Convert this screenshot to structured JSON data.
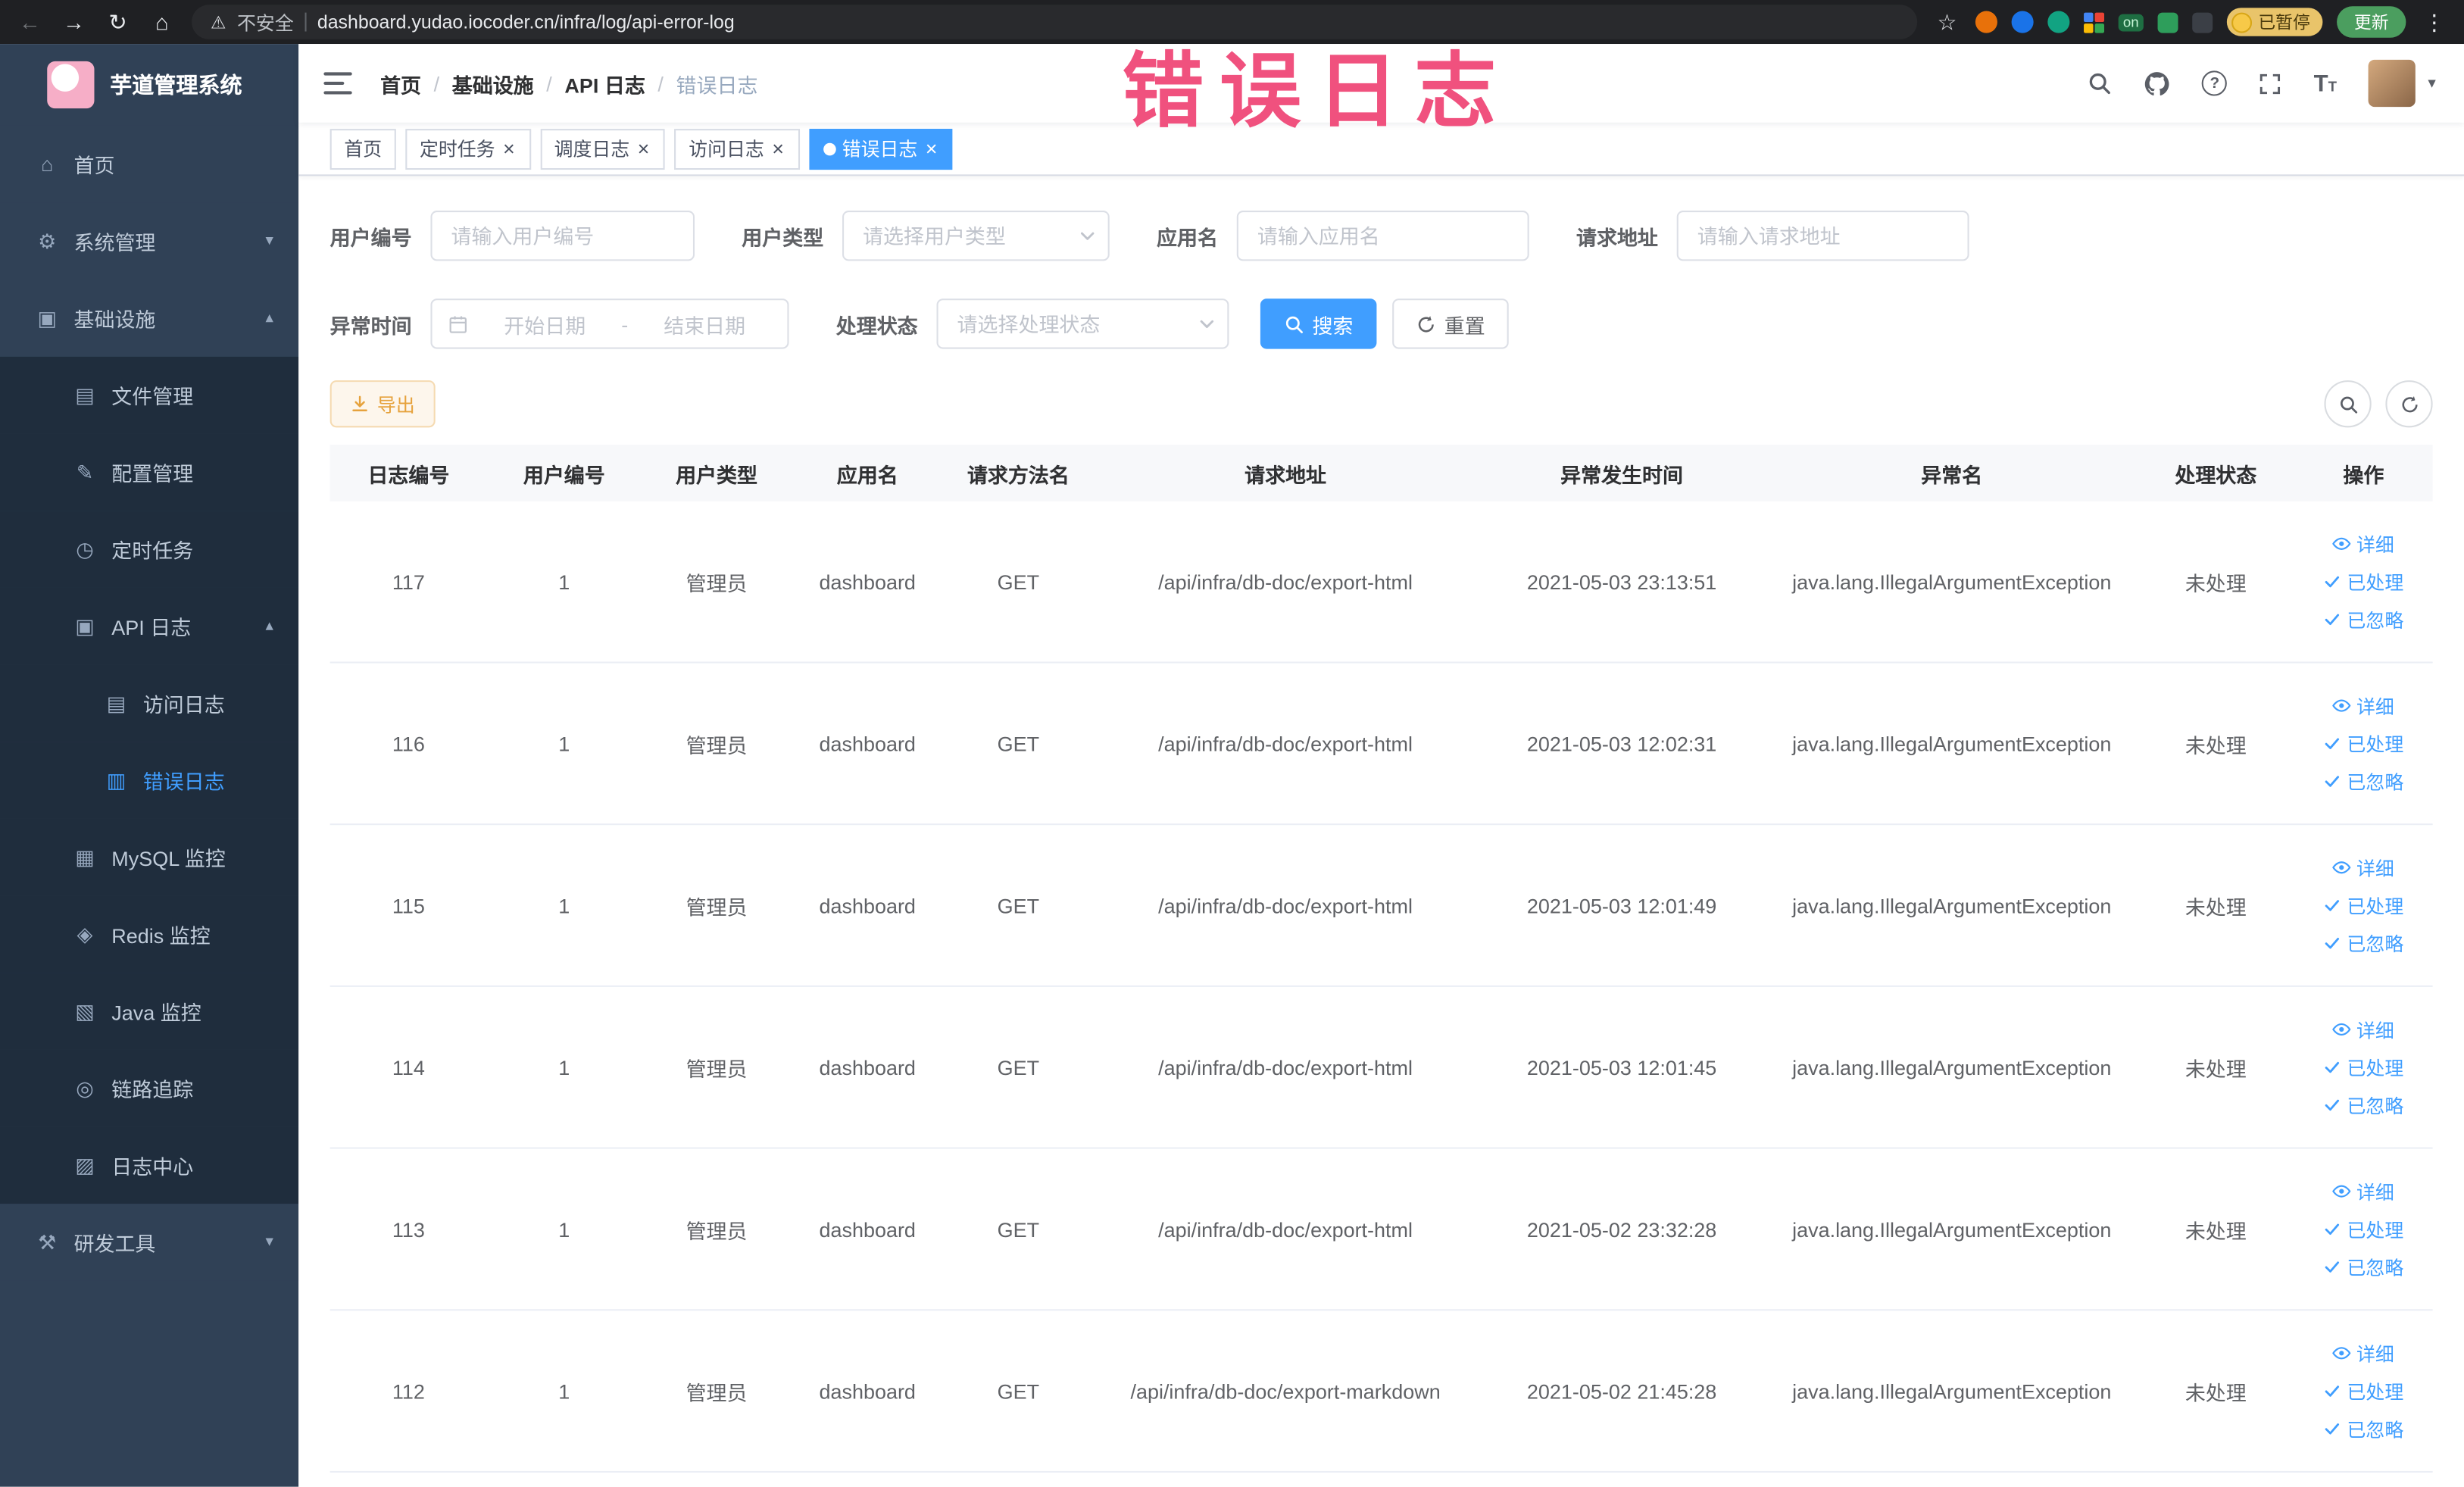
{
  "browser": {
    "security_label": "不安全",
    "url": "dashboard.yudao.iocoder.cn/infra/log/api-error-log",
    "extension_on_badge": "on",
    "paused_badge": "已暂停",
    "update_button": "更新"
  },
  "glyphs": {
    "back": "←",
    "forward": "→",
    "reload": "↻",
    "home": "⌂",
    "warning": "⚠",
    "star": "☆",
    "kebab": "⋮",
    "caret": "▾",
    "question": "?",
    "font": "T",
    "tab_close": "×"
  },
  "watermark": "错误日志",
  "sidebar": {
    "logo_title": "芋道管理系统",
    "items": [
      {
        "label": "首页",
        "icon": "home-icon",
        "glyph": "⌂",
        "level": 0
      },
      {
        "label": "系统管理",
        "icon": "system-manage-icon",
        "glyph": "⚙",
        "level": 0,
        "chevron": "▾"
      },
      {
        "label": "基础设施",
        "icon": "infrastructure-icon",
        "glyph": "▣",
        "level": 0,
        "chevron": "▴",
        "expanded": true
      },
      {
        "label": "文件管理",
        "icon": "file-manage-icon",
        "glyph": "▤",
        "level": 1
      },
      {
        "label": "配置管理",
        "icon": "config-manage-icon",
        "glyph": "✎",
        "level": 1
      },
      {
        "label": "定时任务",
        "icon": "scheduled-job-icon",
        "glyph": "◷",
        "level": 1
      },
      {
        "label": "API 日志",
        "icon": "api-log-icon",
        "glyph": "▣",
        "level": 1,
        "chevron": "▴",
        "expanded": true
      },
      {
        "label": "访问日志",
        "icon": "access-log-icon",
        "glyph": "▤",
        "level": 2
      },
      {
        "label": "错误日志",
        "icon": "error-log-icon",
        "glyph": "▥",
        "level": 2,
        "active": true
      },
      {
        "label": "MySQL 监控",
        "icon": "mysql-monitor-icon",
        "glyph": "▦",
        "level": 1
      },
      {
        "label": "Redis 监控",
        "icon": "redis-monitor-icon",
        "glyph": "◈",
        "level": 1
      },
      {
        "label": "Java 监控",
        "icon": "java-monitor-icon",
        "glyph": "▧",
        "level": 1
      },
      {
        "label": "链路追踪",
        "icon": "trace-icon",
        "glyph": "◎",
        "level": 1
      },
      {
        "label": "日志中心",
        "icon": "log-center-icon",
        "glyph": "▨",
        "level": 1
      },
      {
        "label": "研发工具",
        "icon": "dev-tools-icon",
        "glyph": "⚒",
        "level": 0,
        "chevron": "▾"
      }
    ]
  },
  "header": {
    "separator": "/",
    "breadcrumb": [
      {
        "label": "首页"
      },
      {
        "label": "基础设施"
      },
      {
        "label": "API 日志"
      },
      {
        "label": "错误日志",
        "current": true
      }
    ]
  },
  "tabs": [
    {
      "label": "首页"
    },
    {
      "label": "定时任务",
      "closable": true
    },
    {
      "label": "调度日志",
      "closable": true
    },
    {
      "label": "访问日志",
      "closable": true
    },
    {
      "label": "错误日志",
      "closable": true,
      "active": true
    }
  ],
  "filters": {
    "user_id_label": "用户编号",
    "user_id_placeholder": "请输入用户编号",
    "user_type_label": "用户类型",
    "user_type_placeholder": "请选择用户类型",
    "app_name_label": "应用名",
    "app_name_placeholder": "请输入应用名",
    "request_url_label": "请求地址",
    "request_url_placeholder": "请输入请求地址",
    "exception_time_label": "异常时间",
    "date_start_placeholder": "开始日期",
    "date_separator": "-",
    "date_end_placeholder": "结束日期",
    "process_status_label": "处理状态",
    "process_status_placeholder": "请选择处理状态",
    "search_button": "搜索",
    "reset_button": "重置"
  },
  "toolbar": {
    "export_button": "导出"
  },
  "table": {
    "columns": [
      "日志编号",
      "用户编号",
      "用户类型",
      "应用名",
      "请求方法名",
      "请求地址",
      "异常发生时间",
      "异常名",
      "处理状态",
      "操作"
    ],
    "actions": [
      "详细",
      "已处理",
      "已忽略"
    ],
    "rows": [
      {
        "id": "117",
        "user_id": "1",
        "user_type": "管理员",
        "app_name": "dashboard",
        "method": "GET",
        "url": "/api/infra/db-doc/export-html",
        "time": "2021-05-03 23:13:51",
        "exception": "java.lang.IllegalArgumentException",
        "status": "未处理"
      },
      {
        "id": "116",
        "user_id": "1",
        "user_type": "管理员",
        "app_name": "dashboard",
        "method": "GET",
        "url": "/api/infra/db-doc/export-html",
        "time": "2021-05-03 12:02:31",
        "exception": "java.lang.IllegalArgumentException",
        "status": "未处理"
      },
      {
        "id": "115",
        "user_id": "1",
        "user_type": "管理员",
        "app_name": "dashboard",
        "method": "GET",
        "url": "/api/infra/db-doc/export-html",
        "time": "2021-05-03 12:01:49",
        "exception": "java.lang.IllegalArgumentException",
        "status": "未处理"
      },
      {
        "id": "114",
        "user_id": "1",
        "user_type": "管理员",
        "app_name": "dashboard",
        "method": "GET",
        "url": "/api/infra/db-doc/export-html",
        "time": "2021-05-03 12:01:45",
        "exception": "java.lang.IllegalArgumentException",
        "status": "未处理"
      },
      {
        "id": "113",
        "user_id": "1",
        "user_type": "管理员",
        "app_name": "dashboard",
        "method": "GET",
        "url": "/api/infra/db-doc/export-html",
        "time": "2021-05-02 23:32:28",
        "exception": "java.lang.IllegalArgumentException",
        "status": "未处理"
      },
      {
        "id": "112",
        "user_id": "1",
        "user_type": "管理员",
        "app_name": "dashboard",
        "method": "GET",
        "url": "/api/infra/db-doc/export-markdown",
        "time": "2021-05-02 21:45:28",
        "exception": "java.lang.IllegalArgumentException",
        "status": "未处理"
      }
    ]
  }
}
